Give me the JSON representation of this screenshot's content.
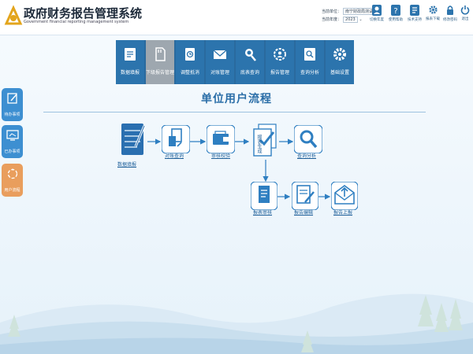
{
  "header": {
    "title": "政府财务报告管理系统",
    "subtitle": "Government financial reporting management system",
    "unit_label": "当前单位：",
    "unit_value": "南宁财政局测试",
    "year_label": "当前年度：",
    "year_value": "2023",
    "tools": [
      {
        "label": "切换年度",
        "icon": "user-icon"
      },
      {
        "label": "使用帮助",
        "icon": "help-icon"
      },
      {
        "label": "技术支持",
        "icon": "support-icon"
      },
      {
        "label": "报表下载",
        "icon": "settings-icon"
      },
      {
        "label": "修改密码",
        "icon": "lock-icon"
      },
      {
        "label": "退出",
        "icon": "power-icon"
      }
    ]
  },
  "nav": [
    {
      "label": "数据填报",
      "icon": "data-entry-icon",
      "active": false
    },
    {
      "label": "下级报告管理",
      "icon": "sd-card-icon",
      "active": true
    },
    {
      "label": "调整抵消",
      "icon": "adjust-icon",
      "active": false
    },
    {
      "label": "对账管理",
      "icon": "mail-icon",
      "active": false
    },
    {
      "label": "底表查询",
      "icon": "search-icon",
      "active": false
    },
    {
      "label": "报告管理",
      "icon": "gear-person-icon",
      "active": false
    },
    {
      "label": "查询分析",
      "icon": "analysis-icon",
      "active": false
    },
    {
      "label": "基础设置",
      "icon": "settings-icon",
      "active": false
    }
  ],
  "side": [
    {
      "label": "待办事项",
      "icon": "edit-icon",
      "color": "#3d8fd1"
    },
    {
      "label": "已办事项",
      "icon": "monitor-icon",
      "color": "#3d8fd1"
    },
    {
      "label": "用户流程",
      "icon": "cycle-icon",
      "color": "#e99e5d"
    }
  ],
  "section_title": "单位用户流程",
  "flow": {
    "data_fill": "数据填报",
    "reconcile": "对账查询",
    "audit_check": "审核校验",
    "gen_report": "报表生成",
    "query_analysis": "查询分析",
    "report_review": "报表审核",
    "report_edit": "报告编辑",
    "report_submit": "报告上报"
  },
  "colors": {
    "primary": "#2c74ad",
    "active": "#9ea7af",
    "flow_blue": "#2f7fc1",
    "accent_orange": "#e99e5d"
  }
}
